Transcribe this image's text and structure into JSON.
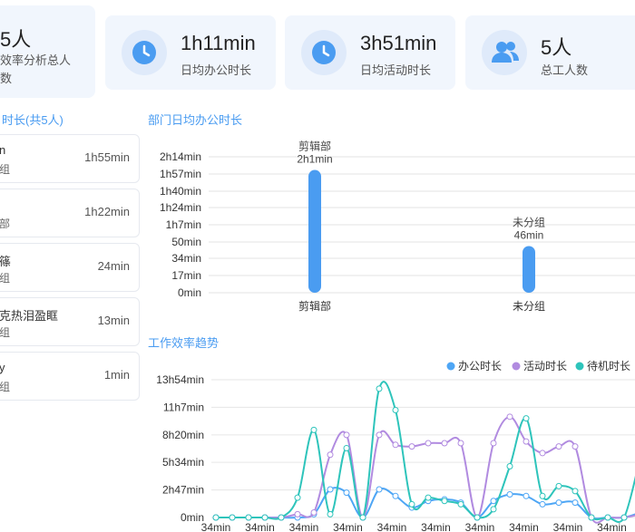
{
  "stats": [
    {
      "value": "5人",
      "label_line1": "效率分析总人",
      "label_line2": "数"
    },
    {
      "value": "1h11min",
      "label": "日均办公时长",
      "icon": "clock-icon"
    },
    {
      "value": "3h51min",
      "label": "日均活动时长",
      "icon": "clock-icon"
    },
    {
      "value": "5人",
      "label": "总工人数",
      "icon": "users-icon"
    }
  ],
  "left_panel": {
    "title": "时长(共5人)",
    "items": [
      {
        "name": "n",
        "dept": "组",
        "time": "1h55min"
      },
      {
        "name": "",
        "dept": "部",
        "time": "1h22min"
      },
      {
        "name": "篠",
        "dept": "组",
        "time": "24min"
      },
      {
        "name": "克热泪盈眶",
        "dept": "组",
        "time": "13min"
      },
      {
        "name": "y",
        "dept": "组",
        "time": "1min"
      }
    ]
  },
  "dept_chart": {
    "title": "部门日均办公时长"
  },
  "trend_chart": {
    "title": "工作效率趋势"
  },
  "colors": {
    "accent": "#4a9cf1",
    "office": "#4ea6f5",
    "activity": "#b18be0",
    "idle": "#2ec4bb"
  },
  "chart_data": [
    {
      "type": "bar",
      "categories": [
        "剪辑部",
        "未分组"
      ],
      "values": [
        121,
        46
      ],
      "data_labels": [
        "2h1min",
        "46min"
      ],
      "ylim": [
        0,
        134
      ],
      "yticks": [
        0,
        17,
        34,
        50,
        67,
        84,
        100,
        117,
        134
      ],
      "ytick_labels": [
        "0min",
        "17min",
        "34min",
        "50min",
        "1h7min",
        "1h24min",
        "1h40min",
        "1h57min",
        "2h14min"
      ],
      "grid": true
    },
    {
      "type": "line",
      "ylim": [
        0,
        834
      ],
      "yticks": [
        0,
        167,
        334,
        500,
        667,
        834
      ],
      "ytick_labels": [
        "0min",
        "2h47min",
        "5h34min",
        "8h20min",
        "11h7min",
        "13h54min"
      ],
      "x_tick_labels": [
        "34min",
        "34min",
        "34min",
        "34min",
        "34min",
        "34min",
        "34min",
        "34min",
        "34min",
        "34min"
      ],
      "legend_position": "top-right",
      "grid": true,
      "series": [
        {
          "name": "办公时长",
          "values": [
            0,
            0,
            0,
            0,
            0,
            0,
            20,
            170,
            150,
            0,
            170,
            130,
            60,
            100,
            110,
            90,
            0,
            100,
            140,
            130,
            80,
            90,
            90,
            0,
            0,
            0,
            30
          ]
        },
        {
          "name": "活动时长",
          "values": [
            0,
            0,
            0,
            0,
            0,
            20,
            30,
            380,
            500,
            0,
            500,
            440,
            430,
            450,
            450,
            450,
            0,
            450,
            610,
            460,
            390,
            430,
            430,
            0,
            0,
            0,
            20
          ]
        },
        {
          "name": "待机时长",
          "values": [
            0,
            0,
            0,
            0,
            0,
            120,
            530,
            20,
            420,
            0,
            780,
            650,
            80,
            120,
            100,
            80,
            0,
            50,
            310,
            600,
            130,
            190,
            160,
            0,
            0,
            0,
            370
          ]
        }
      ]
    }
  ]
}
